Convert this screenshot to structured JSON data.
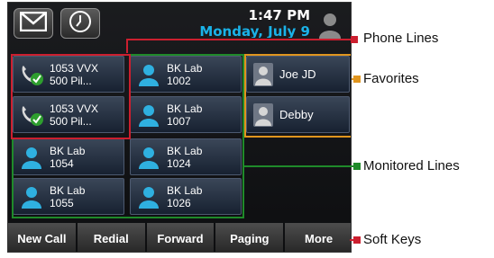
{
  "status": {
    "time": "1:47 PM",
    "date": "Monday, July 9"
  },
  "top_buttons": {
    "messages_icon": "envelope-icon",
    "history_icon": "clock-icon"
  },
  "phone_lines": [
    {
      "name": "1053 VVX",
      "number": "500 Pil..."
    },
    {
      "name": "1053 VVX",
      "number": "500 Pil..."
    }
  ],
  "monitored_lines": [
    {
      "name": "BK Lab",
      "number": "1002"
    },
    {
      "name": "BK Lab",
      "number": "1007"
    },
    {
      "name": "BK Lab",
      "number": "1054"
    },
    {
      "name": "BK Lab",
      "number": "1024"
    },
    {
      "name": "BK Lab",
      "number": "1055"
    },
    {
      "name": "BK Lab",
      "number": "1026"
    }
  ],
  "favorites": [
    {
      "name": "Joe JD"
    },
    {
      "name": "Debby"
    }
  ],
  "soft_keys": [
    "New Call",
    "Redial",
    "Forward",
    "Paging",
    "More"
  ],
  "callouts": {
    "phone_lines": "Phone Lines",
    "favorites": "Favorites",
    "monitored_lines": "Monitored Lines",
    "soft_keys": "Soft Keys"
  },
  "colors": {
    "phone_lines": "#cc1f2f",
    "favorites": "#e0951e",
    "monitored_lines": "#1f8a2a",
    "soft_keys": "#cc1f2f",
    "date": "#1ab2e8"
  }
}
